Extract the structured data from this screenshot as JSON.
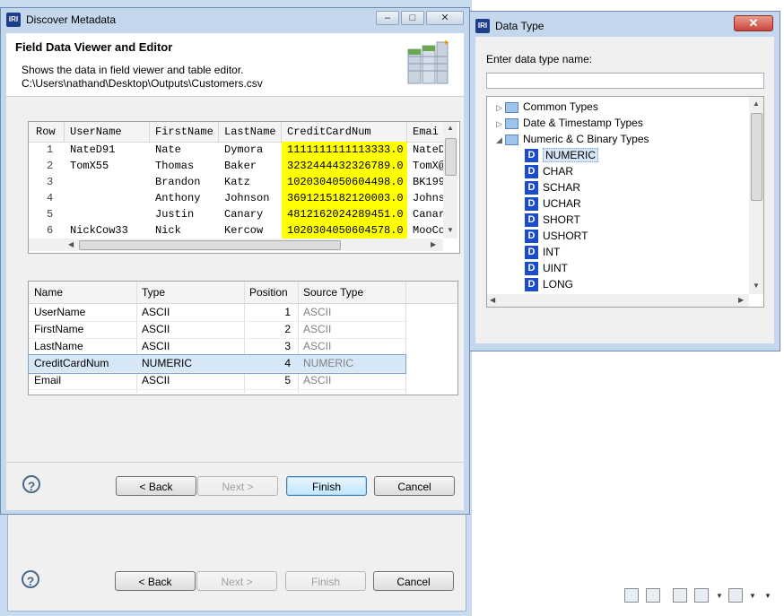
{
  "main_dialog": {
    "title": "Discover Metadata",
    "app_icon": "IRI",
    "page_title": "Field Data Viewer and Editor",
    "description": "Shows the data in field viewer and table editor.",
    "file_path": "C:\\Users\\nathand\\Desktop\\Outputs\\Customers.csv",
    "window_controls": [
      "minimize-icon",
      "maximize-icon",
      "close-icon"
    ]
  },
  "data_table": {
    "columns": [
      "Row",
      "UserName",
      "FirstName",
      "LastName",
      "CreditCardNum",
      "Emai"
    ],
    "rows": [
      [
        "1",
        "NateD91",
        "Nate",
        "Dymora",
        "1111111111113333.0",
        "NateD"
      ],
      [
        "2",
        "TomX55",
        "Thomas",
        "Baker",
        "3232444432326789.0",
        "TomX@"
      ],
      [
        "3",
        "",
        "Brandon",
        "Katz",
        "1020304050604498.0",
        "BK199"
      ],
      [
        "4",
        "",
        "Anthony",
        "Johnson",
        "3691215182120003.0",
        "Johns"
      ],
      [
        "5",
        "",
        "Justin",
        "Canary",
        "4812162024289451.0",
        "Canar"
      ],
      [
        "6",
        "NickCow33",
        "Nick",
        "Kercow",
        "1020304050604578.0",
        "MooCo"
      ],
      [
        "7",
        "",
        "",
        "",
        "",
        ""
      ]
    ],
    "highlight_color": "#ffff00"
  },
  "field_table": {
    "columns": [
      "Name",
      "Type",
      "Position",
      "Source Type"
    ],
    "rows": [
      [
        "UserName",
        "ASCII",
        "1",
        "ASCII"
      ],
      [
        "FirstName",
        "ASCII",
        "2",
        "ASCII"
      ],
      [
        "LastName",
        "ASCII",
        "3",
        "ASCII"
      ],
      [
        "CreditCardNum",
        "NUMERIC",
        "4",
        "NUMERIC"
      ],
      [
        "Email",
        "ASCII",
        "5",
        "ASCII"
      ]
    ],
    "selected_row": "CreditCardNum"
  },
  "buttons": {
    "back": "< Back",
    "next": "Next >",
    "finish": "Finish",
    "cancel": "Cancel"
  },
  "background_buttons": {
    "back": "< Back",
    "next": "Next >",
    "finish": "Finish",
    "cancel": "Cancel"
  },
  "data_type_window": {
    "title": "Data Type",
    "app_icon": "IRI",
    "prompt": "Enter data type name:",
    "input_value": "",
    "tree": {
      "groups": [
        "Common Types",
        "Date & Timestamp Types",
        "Numeric & C Binary Types"
      ],
      "items": [
        "NUMERIC",
        "CHAR",
        "SCHAR",
        "UCHAR",
        "SHORT",
        "USHORT",
        "INT",
        "UINT",
        "LONG"
      ],
      "item_icon": "D",
      "selected": "NUMERIC"
    }
  },
  "colors": {
    "selection": "#d6e8f8",
    "accent": "#1b4ccd",
    "close": "#c9453a"
  }
}
